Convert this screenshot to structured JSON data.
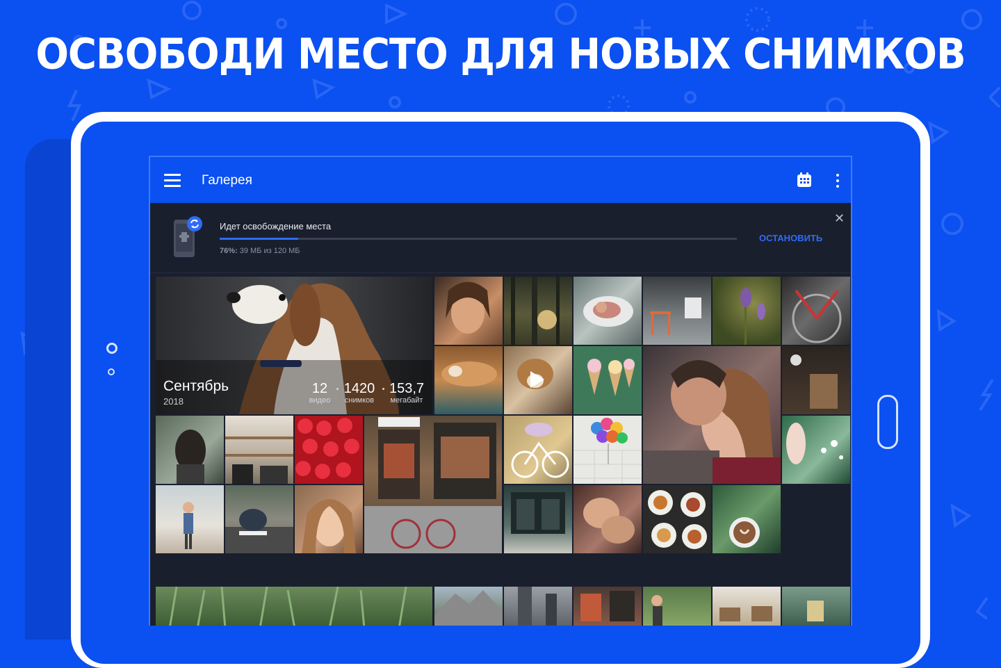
{
  "headline": "ОСВОБОДИ МЕСТО ДЛЯ НОВЫХ СНИМКОВ",
  "app": {
    "title": "Галерея",
    "icons": [
      "menu-icon",
      "calendar-icon",
      "more-vert-icon"
    ]
  },
  "banner": {
    "title": "Идет освобождение места",
    "progress_percent": 76,
    "progress_label": "76%:",
    "progress_detail": " 39 МБ из 120 МБ",
    "stop_label": "ОСТАНОВИТЬ",
    "close_label": "✕"
  },
  "featured": {
    "month": "Сентябрь",
    "year": "2018",
    "stats": [
      {
        "value": "12",
        "label": "видео"
      },
      {
        "value": "1420",
        "label": "снимков"
      },
      {
        "value": "153,7",
        "label": "мегабайт"
      }
    ]
  },
  "colors": {
    "background": "#0b50f0",
    "accent": "#2f6cf6",
    "screen_bg": "#1a1f2e"
  }
}
